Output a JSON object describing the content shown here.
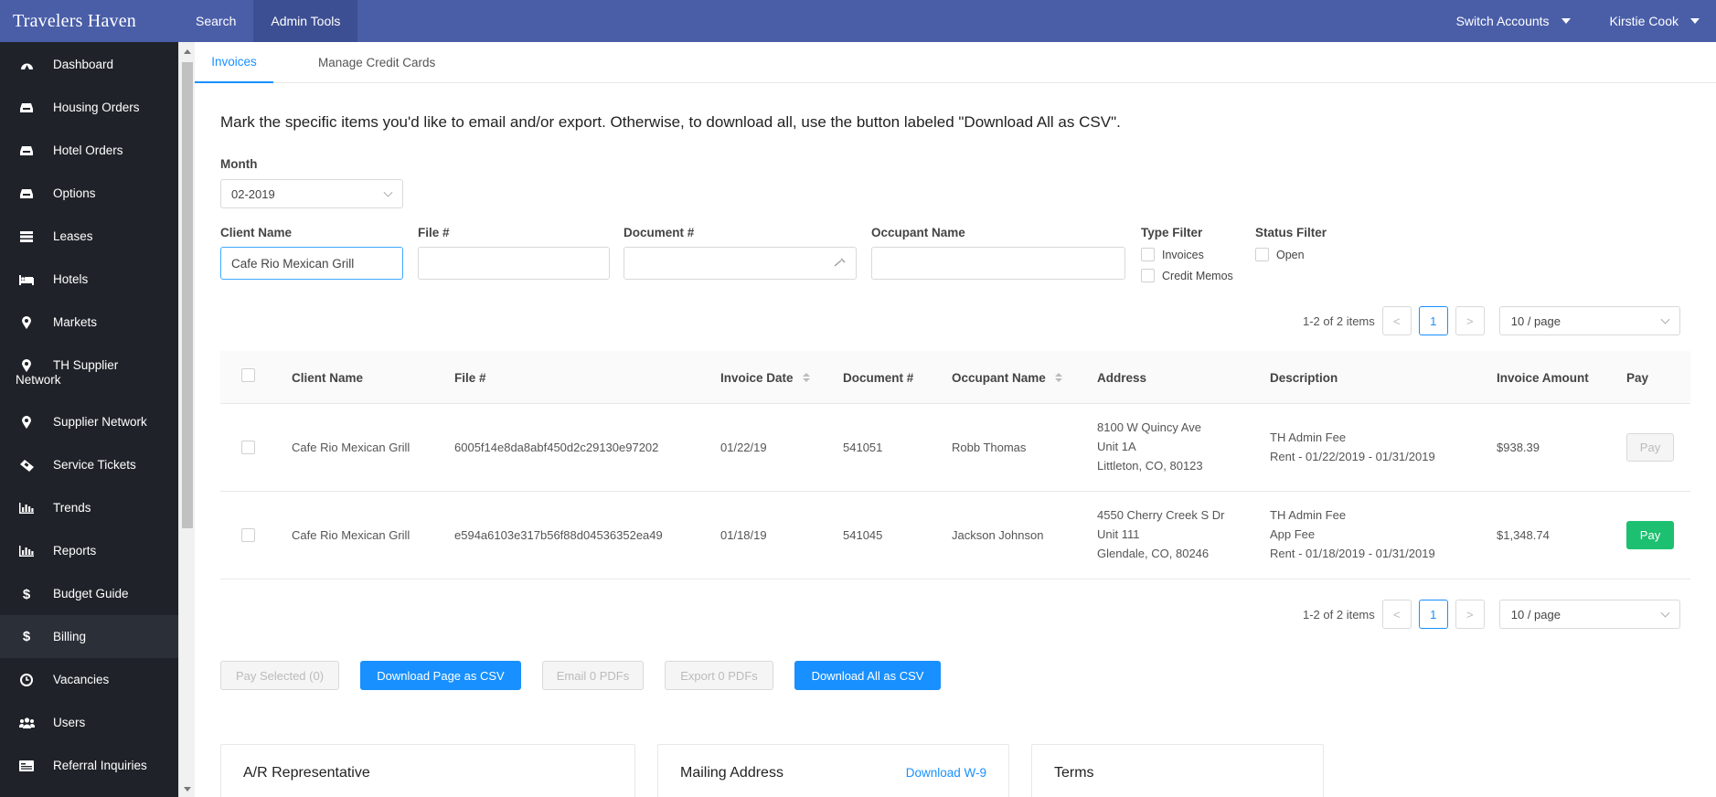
{
  "topbar": {
    "brand": "Travelers Haven",
    "nav": [
      "Search",
      "Admin Tools"
    ],
    "switch_accounts": "Switch Accounts",
    "user": "Kirstie Cook"
  },
  "sidebar": {
    "items": [
      {
        "label": "Dashboard",
        "icon": "dashboard-icon"
      },
      {
        "label": "Housing Orders",
        "icon": "inbox-icon"
      },
      {
        "label": "Hotel Orders",
        "icon": "inbox-icon"
      },
      {
        "label": "Options",
        "icon": "inbox-icon"
      },
      {
        "label": "Leases",
        "icon": "list-icon"
      },
      {
        "label": "Hotels",
        "icon": "bed-icon"
      },
      {
        "label": "Markets",
        "icon": "map-marker-icon"
      },
      {
        "label": "TH Supplier\nNetwork",
        "icon": "map-marker-icon"
      },
      {
        "label": "Supplier Network",
        "icon": "map-marker-icon"
      },
      {
        "label": "Service Tickets",
        "icon": "ticket-icon"
      },
      {
        "label": "Trends",
        "icon": "bar-chart-icon"
      },
      {
        "label": "Reports",
        "icon": "bar-chart-icon"
      },
      {
        "label": "Budget Guide",
        "icon": "dollar-icon"
      },
      {
        "label": "Billing",
        "icon": "dollar-icon"
      },
      {
        "label": "Vacancies",
        "icon": "clock-icon"
      },
      {
        "label": "Users",
        "icon": "users-icon"
      },
      {
        "label": "Referral Inquiries",
        "icon": "id-card-icon"
      }
    ],
    "active": "Billing"
  },
  "tabs": [
    "Invoices",
    "Manage Credit Cards"
  ],
  "intro": "Mark the specific items you'd like to email and/or export. Otherwise, to download all, use the button labeled \"Download All as CSV\".",
  "filters": {
    "month_label": "Month",
    "month_value": "02-2019",
    "client_label": "Client Name",
    "client_value": "Cafe Rio Mexican Grill",
    "file_label": "File #",
    "file_value": "",
    "document_label": "Document #",
    "document_value": "",
    "occupant_label": "Occupant Name",
    "occupant_value": "",
    "type_filter_label": "Type Filter",
    "type_options": [
      "Invoices",
      "Credit Memos"
    ],
    "status_filter_label": "Status Filter",
    "status_options": [
      "Open"
    ]
  },
  "pagination": {
    "info": "1-2 of 2 items",
    "current_page": "1",
    "page_size": "10 / page",
    "prev": "<",
    "next": ">"
  },
  "table": {
    "headers": [
      "Client Name",
      "File #",
      "Invoice Date",
      "Document #",
      "Occupant Name",
      "Address",
      "Description",
      "Invoice Amount",
      "Pay"
    ],
    "rows": [
      {
        "client": "Cafe Rio Mexican Grill",
        "file": "6005f14e8da8abf450d2c29130e97202",
        "date": "01/22/19",
        "document": "541051",
        "occupant": "Robb Thomas",
        "address": [
          "8100 W Quincy Ave",
          "Unit 1A",
          "Littleton, CO, 80123"
        ],
        "description": [
          "TH Admin Fee",
          "Rent - 01/22/2019 - 01/31/2019"
        ],
        "amount": "$938.39",
        "pay": "Pay",
        "pay_enabled": false
      },
      {
        "client": "Cafe Rio Mexican Grill",
        "file": "e594a6103e317b56f88d04536352ea49",
        "date": "01/18/19",
        "document": "541045",
        "occupant": "Jackson Johnson",
        "address": [
          "4550 Cherry Creek S Dr",
          "Unit 111",
          "Glendale, CO, 80246"
        ],
        "description": [
          "TH Admin Fee",
          "App Fee",
          "Rent - 01/18/2019 - 01/31/2019"
        ],
        "amount": "$1,348.74",
        "pay": "Pay",
        "pay_enabled": true
      }
    ]
  },
  "actions": {
    "pay_selected": "Pay Selected (0)",
    "download_page": "Download Page as CSV",
    "email_pdfs": "Email 0 PDFs",
    "export_pdfs": "Export 0 PDFs",
    "download_all": "Download All as CSV"
  },
  "cards": {
    "ar_rep": "A/R Representative",
    "mailing": "Mailing Address",
    "download_w9": "Download W-9",
    "terms": "Terms"
  },
  "colors": {
    "topbar": "#4a5ea8",
    "sidebar": "#1f2329",
    "primary": "#1890ff",
    "pay_green": "#1dc070"
  }
}
